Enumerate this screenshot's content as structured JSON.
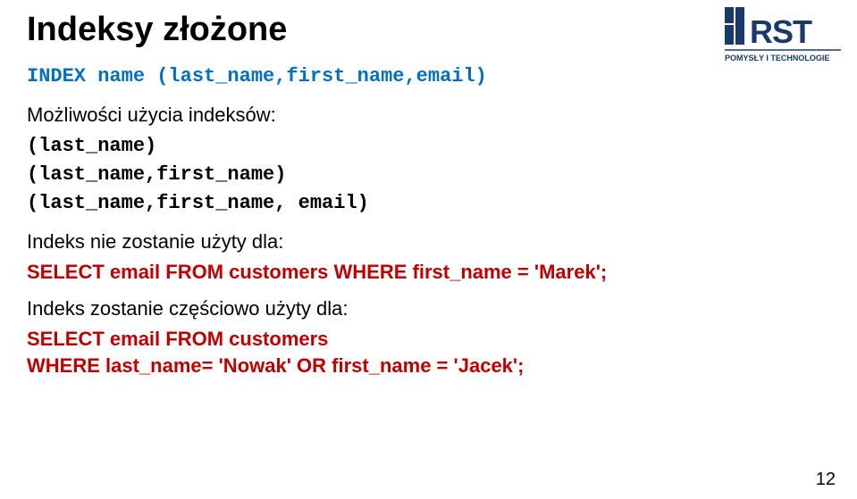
{
  "title": "Indeksy złożone",
  "index_def": "INDEX name (last_name,first_name,email)",
  "possibilities_label": "Możliwości użycia indeksów:",
  "index_combos": [
    "(last_name)",
    "(last_name,first_name)",
    "(last_name,first_name, email)"
  ],
  "not_used_label": "Indeks nie zostanie użyty dla:",
  "sql1": "SELECT email FROM customers WHERE first_name = 'Marek';",
  "partial_label": "Indeks zostanie częściowo użyty dla:",
  "sql2_line1": "SELECT email FROM customers",
  "sql2_line2": "WHERE last_name= 'Nowak' OR first_name = 'Jacek';",
  "logo": {
    "text_main": "RST",
    "text_sub": "POMYSŁY I TECHNOLOGIE",
    "color": "#1a3a6e"
  },
  "page_number": "12"
}
